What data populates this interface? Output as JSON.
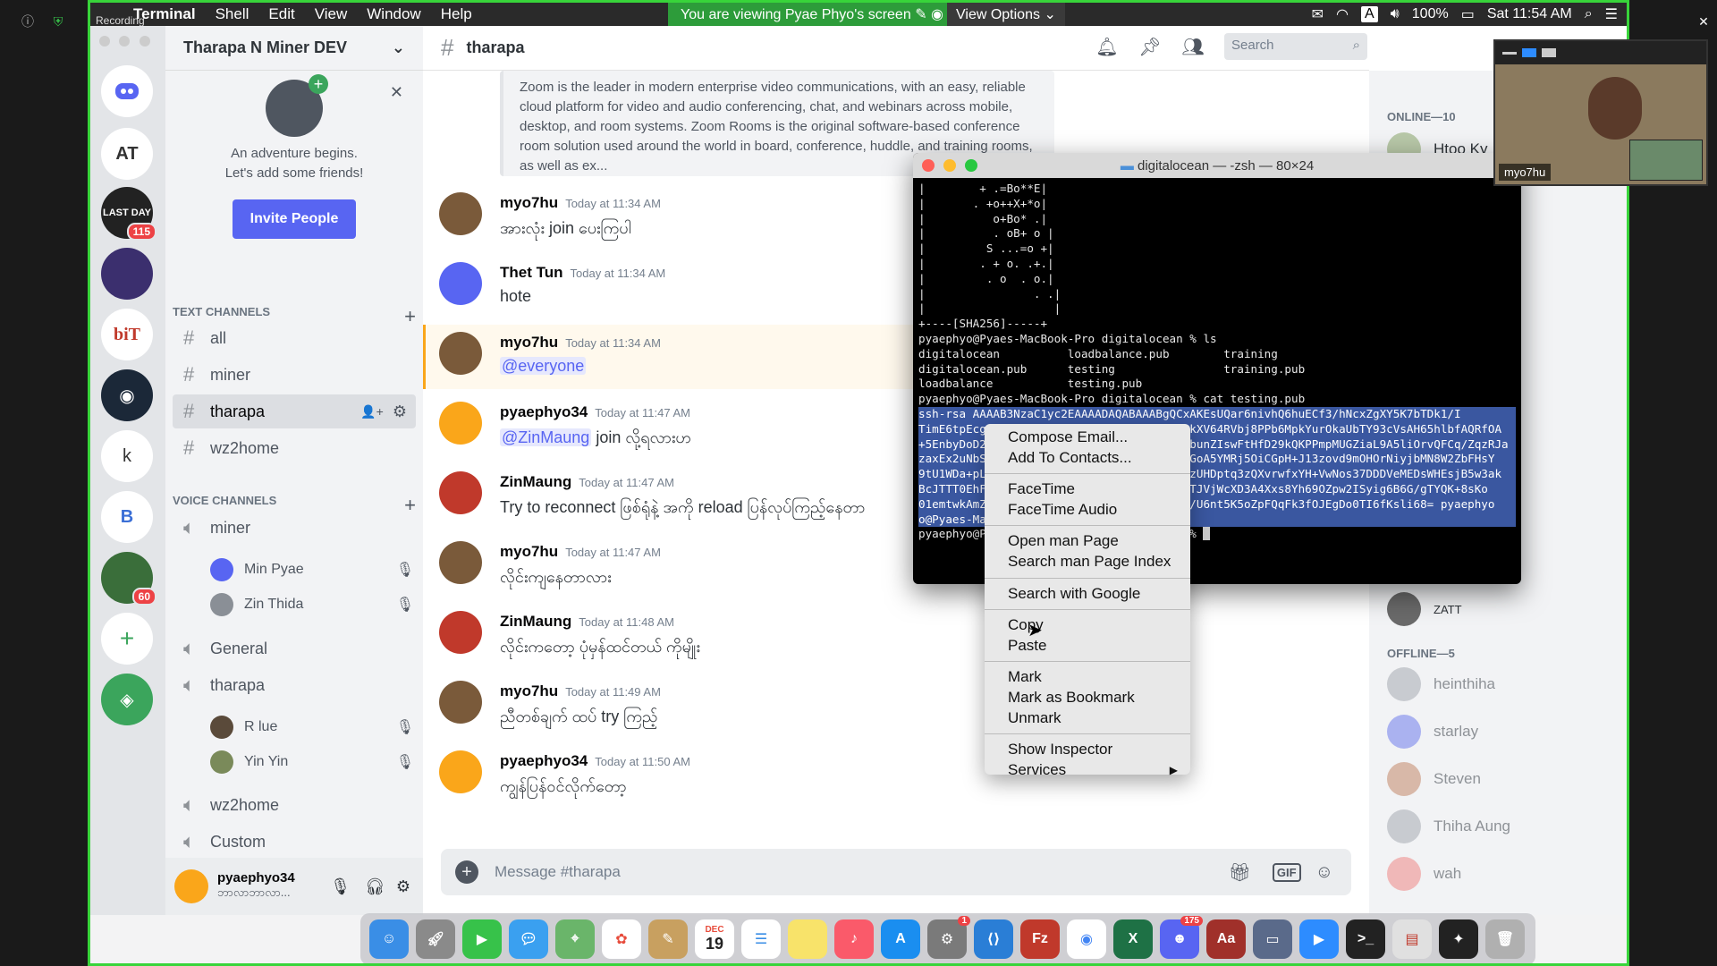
{
  "zoom": {
    "viewing_text": "You are viewing Pyae Phyo's screen",
    "view_options": "View Options",
    "recording": "Recording"
  },
  "menubar": {
    "app": "Terminal",
    "items": [
      "Shell",
      "Edit",
      "View",
      "Window",
      "Help"
    ],
    "battery": "100%",
    "clock": "Sat 11:54 AM",
    "input_source": "A"
  },
  "guild": {
    "name": "Tharapa N Miner DEV",
    "invite_line1": "An adventure begins.",
    "invite_line2": "Let's add some friends!",
    "invite_button": "Invite People"
  },
  "servers": [
    {
      "label": "",
      "icon": "discord-home-icon"
    },
    {
      "label": "AT"
    },
    {
      "label": "LAST DAY",
      "badge": "115"
    },
    {
      "label": ""
    },
    {
      "label": "biT"
    },
    {
      "label": ""
    },
    {
      "label": "k"
    },
    {
      "label": "B"
    },
    {
      "label": "",
      "badge": "60"
    }
  ],
  "text_channels": {
    "title": "TEXT CHANNELS",
    "items": [
      "all",
      "miner",
      "tharapa",
      "wz2home"
    ]
  },
  "voice_channels": {
    "title": "VOICE CHANNELS",
    "items": [
      {
        "name": "miner",
        "users": [
          "Min Pyae",
          "Zin Thida"
        ]
      },
      {
        "name": "General",
        "users": []
      },
      {
        "name": "tharapa",
        "users": [
          "R lue",
          "Yin Yin"
        ]
      },
      {
        "name": "wz2home",
        "users": []
      },
      {
        "name": "Custom",
        "users": []
      }
    ]
  },
  "user": {
    "name": "pyaephyo34",
    "status": "ဘာလာဘာလာ..."
  },
  "chat": {
    "channel": "tharapa",
    "search_placeholder": "Search",
    "embed_text": "Zoom is the leader in modern enterprise video communications, with an easy, reliable cloud platform for video and audio conferencing, chat, and webinars across mobile, desktop, and room systems. Zoom Rooms is the original software-based conference room solution used around the world in board, conference, huddle, and training rooms, as well as ex...",
    "messages": [
      {
        "author": "myo7hu",
        "time": "Today at 11:34 AM",
        "text": "အားလုံး join ပေးကြပါ"
      },
      {
        "author": "Thet Tun",
        "time": "Today at 11:34 AM",
        "text": "hote"
      },
      {
        "author": "myo7hu",
        "time": "Today at 11:34 AM",
        "text": "@everyone"
      },
      {
        "author": "pyaephyo34",
        "time": "Today at 11:47 AM",
        "mention": "@ZinMaung",
        "text": "join လို့ရလားဟ"
      },
      {
        "author": "ZinMaung",
        "time": "Today at 11:47 AM",
        "text": "Try to reconnect ဖြစ်ရုံနဲ့ အကို reload ပြန်လုပ်ကြည့်နေတာ"
      },
      {
        "author": "myo7hu",
        "time": "Today at 11:47 AM",
        "text": "လိုင်းကျနေတာလား"
      },
      {
        "author": "ZinMaung",
        "time": "Today at 11:48 AM",
        "text": "လိုင်းကတော့ ပုံမှန်ထင်တယ် ကိုမျိုး"
      },
      {
        "author": "myo7hu",
        "time": "Today at 11:49 AM",
        "text": "ညီတစ်ချက် ထပ် try ကြည့်"
      },
      {
        "author": "pyaephyo34",
        "time": "Today at 11:50 AM",
        "text": "ကျွန်ပြန်ဝင်လိုက်တော့"
      }
    ],
    "message_placeholder": "Message #tharapa"
  },
  "members": {
    "online_title": "ONLINE—10",
    "online": [
      "Htoo Ky"
    ],
    "online_partial": [
      "ZATT"
    ],
    "offline_title": "OFFLINE—5",
    "offline": [
      "heinthiha",
      "starlay",
      "Steven",
      "Thiha Aung",
      "wah"
    ]
  },
  "terminal": {
    "title": "digitalocean — -zsh — 80×24",
    "lines": [
      "|        + .=Bo**E|",
      "|       . +o++X+*o|",
      "|          o+Bo* .|",
      "|          . oB+ o |",
      "|         S ...=o +|",
      "|        . + o. .+.|",
      "|         . o  . o.|",
      "|                . .|",
      "|                   |",
      "+----[SHA256]-----+",
      "pyaephyo@Pyaes-MacBook-Pro digitalocean % ls",
      "digitalocean          loadbalance.pub        training",
      "digitalocean.pub      testing                training.pub",
      "loadbalance           testing.pub",
      "pyaephyo@Pyaes-MacBook-Pro digitalocean % cat testing.pub"
    ],
    "selected_lines": [
      "ssh-rsa AAAAB3NzaC1yc2EAAAADAQABAAABgQCxAKEsUQar6nivhQ6huECf3/hNcxZgXY5K7bTDk1/I",
      "TimE6tpEcgsdL8ElvRTWcNk7Bn8dbg5ae23BD2k4kXV64RVbj8PPb6MpkYurOkaUbTY93cVsAH65hlbfAQRfOA",
      "+5EnbyDoD2tH0qM1Jw5sdLn0Rt3kjT5B6xKPrqR4bunZIswFtHfD29kQKPPmpMUGZiaL9A5liOrvQFCq/ZqzRJa",
      "zaxEx2uNbS0n2hT8qCKmLp0nA4ZgWk98Tr7UbVBcGoA5YMRj5OiCGpH+J13zovd9mOHOrNiyjbMN8W2ZbFHsY",
      "9tU1WDa+pLqZd9P8vGmRs6HwYjXcA2k9DtQxTrQEzUHDptq3zQXvrwfxYH+VwNos37DDDVeMEDsWHEsjB5w3ak",
      "BcJTTT0EhF4o2PpNvWd5iX8sL3yRq1uT7GeFKcLNTJVjWcXD3A4Xxs8Yh69OZpw2ISyig6B6G/gTYQK+8sKo",
      "01emtwkAmZqL4Hb2Y9nTfRs6dC0xPjV1gGUkE3bM/U6nt5K5oZpFQqFk3fOJEgDo0TI6fKsli68= pyaephyo",
      "o@Pyaes-MacBook-Pro.local"
    ],
    "prompt": "pyaephyo@Pyaes-MacBook-Pro digitalocean % "
  },
  "context_menu": {
    "groups": [
      [
        "Compose Email...",
        "Add To Contacts..."
      ],
      [
        "FaceTime",
        "FaceTime Audio"
      ],
      [
        "Open man Page",
        "Search man Page Index"
      ],
      [
        "Search with Google"
      ],
      [
        "Copy",
        "Paste"
      ],
      [
        "Mark",
        "Mark as Bookmark",
        "Unmark"
      ],
      [
        "Show Inspector",
        "Services"
      ]
    ]
  },
  "video": {
    "name": "myo7hu"
  },
  "dock": {
    "items": [
      "Finder",
      "Launchpad",
      "FaceTime",
      "Messages",
      "Maps",
      "Photos",
      "Notes",
      "Calendar",
      "Reminders",
      "Stickies",
      "Music",
      "App Store",
      "System Preferences",
      "VS Code",
      "FileZilla",
      "Chrome",
      "Excel",
      "Discord",
      "Dictionary",
      "Preview",
      "Zoom",
      "Terminal",
      "Scanner",
      "Inkscape",
      "Trash"
    ],
    "calendar_date": "19",
    "discord_badge": "175",
    "syspref_badge": "1",
    "calendar_month": "DEC"
  }
}
